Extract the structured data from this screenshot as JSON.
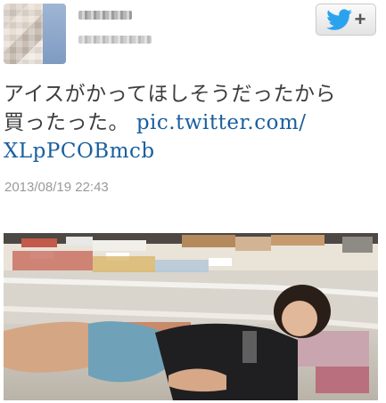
{
  "tweet": {
    "text_line1": "アイスがかってほしそうだったから",
    "text_line2": "買ったった。",
    "link_part1": "pic.twitter.com/",
    "link_part2": "XLpPCOBmcb",
    "timestamp": "2013/08/19 22:43"
  },
  "follow_button": {
    "icon": "twitter-bird-icon",
    "plus": "+"
  },
  "colors": {
    "link": "#1a5f9e",
    "text": "#3d3d3d",
    "timestamp": "#9a9a9a",
    "twitter_blue": "#2aa3ef"
  }
}
